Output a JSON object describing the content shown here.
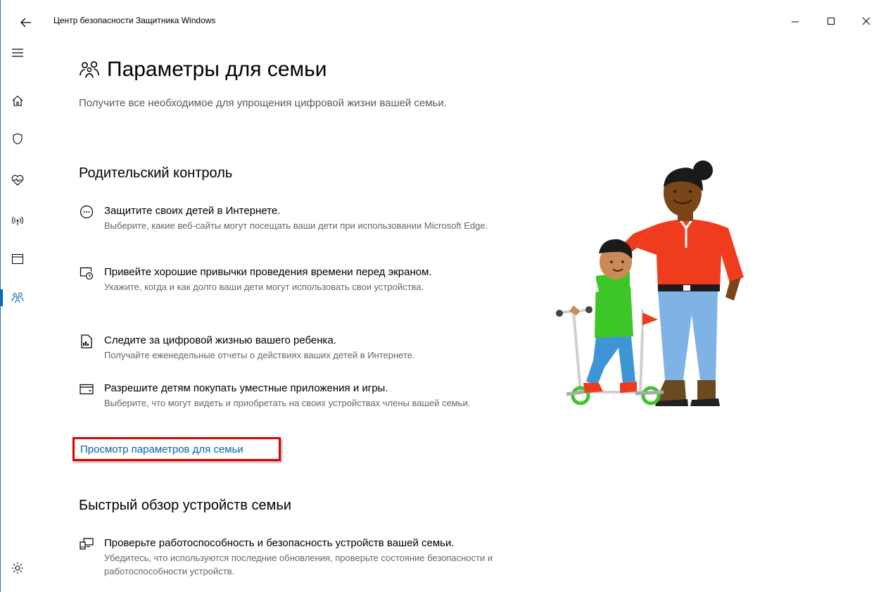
{
  "window": {
    "title": "Центр безопасности Защитника Windows"
  },
  "nav": {
    "items": [
      "menu-icon",
      "home-icon",
      "shield-icon",
      "heart-icon",
      "wireless-icon",
      "browser-window-icon",
      "family-icon",
      "settings-icon"
    ],
    "active": "family-icon"
  },
  "page": {
    "title": "Параметры для семьи",
    "description": "Получите все необходимое для упрощения цифровой жизни вашей семьи."
  },
  "parental": {
    "heading": "Родительский контроль",
    "items": [
      {
        "icon": "smiley-icon",
        "title": "Защитите своих детей в Интернете.",
        "desc": "Выберите, какие веб-сайты могут посещать ваши дети при использовании Microsoft Edge."
      },
      {
        "icon": "screen-time-icon",
        "title": "Привейте хорошие привычки проведения времени перед экраном.",
        "desc": "Укажите, когда и как долго ваши дети могут использовать свои устройства."
      },
      {
        "icon": "report-icon",
        "title": "Следите за цифровой жизнью вашего ребенка.",
        "desc": "Получайте еженедельные отчеты о действиях ваших детей в Интернете."
      },
      {
        "icon": "wallet-icon",
        "title": "Разрешите детям покупать уместные приложения и игры.",
        "desc": "Выберите, что могут видеть и приобретать на своих устройствах члены вашей семьи."
      }
    ],
    "link": "Просмотр параметров для семьи"
  },
  "devices": {
    "heading": "Быстрый обзор устройств семьи",
    "items": [
      {
        "icon": "devices-icon",
        "title": "Проверьте работоспособность и безопасность устройств вашей семьи.",
        "desc": "Убедитесь, что используются последние обновления, проверьте состояние безопасности и работоспособности устройств."
      }
    ]
  },
  "colors": {
    "accent": "#0063b1",
    "highlight": "#e00000"
  }
}
